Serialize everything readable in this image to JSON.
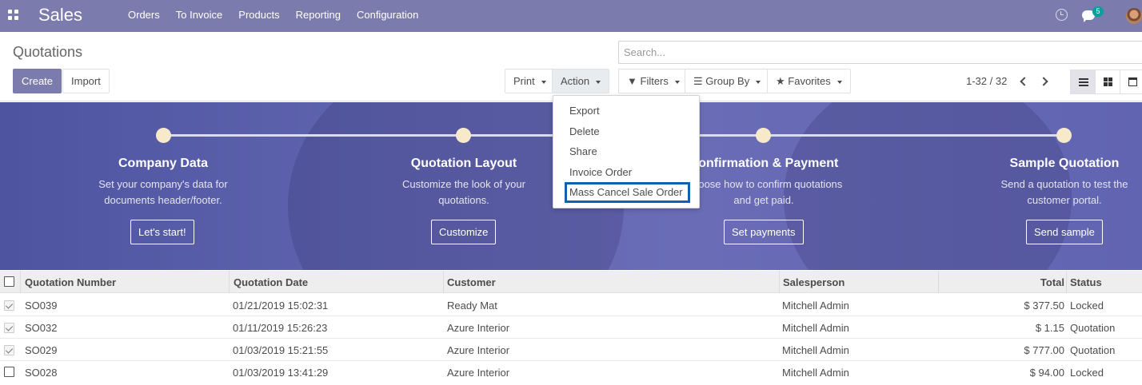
{
  "navbar": {
    "brand": "Sales",
    "menu": [
      "Orders",
      "To Invoice",
      "Products",
      "Reporting",
      "Configuration"
    ],
    "notification_count": "5"
  },
  "control_panel": {
    "title": "Quotations",
    "create_label": "Create",
    "import_label": "Import",
    "print_label": "Print",
    "action_label": "Action",
    "filters_label": "Filters",
    "group_by_label": "Group By",
    "favorites_label": "Favorites",
    "search_placeholder": "Search...",
    "pager": "1-32 / 32"
  },
  "action_menu": {
    "items": [
      "Export",
      "Delete",
      "Share",
      "Invoice Order",
      "Mass Cancel Sale Order"
    ],
    "highlighted": "Mass Cancel Sale Order"
  },
  "onboarding": {
    "steps": [
      {
        "title": "Company Data",
        "desc1": "Set your company's data for",
        "desc2": "documents header/footer.",
        "button": "Let's start!"
      },
      {
        "title": "Quotation Layout",
        "desc1": "Customize the look of your",
        "desc2": "quotations.",
        "button": "Customize"
      },
      {
        "title": "Confirmation & Payment",
        "desc1": "Choose how to confirm quotations",
        "desc2": "and get paid.",
        "button": "Set payments"
      },
      {
        "title": "Sample Quotation",
        "desc1": "Send a quotation to test the",
        "desc2": "customer portal.",
        "button": "Send sample"
      }
    ]
  },
  "table": {
    "columns": [
      "Quotation Number",
      "Quotation Date",
      "Customer",
      "Salesperson",
      "Total",
      "Status"
    ],
    "rows": [
      {
        "number": "SO039",
        "date": "01/21/2019 15:02:31",
        "customer": "Ready Mat",
        "salesperson": "Mitchell Admin",
        "total": "$ 377.50",
        "status": "Locked",
        "checked": true
      },
      {
        "number": "SO032",
        "date": "01/11/2019 15:26:23",
        "customer": "Azure Interior",
        "salesperson": "Mitchell Admin",
        "total": "$ 1.15",
        "status": "Quotation",
        "checked": true
      },
      {
        "number": "SO029",
        "date": "01/03/2019 15:21:55",
        "customer": "Azure Interior",
        "salesperson": "Mitchell Admin",
        "total": "$ 777.00",
        "status": "Quotation",
        "checked": true
      },
      {
        "number": "SO028",
        "date": "01/03/2019 13:41:29",
        "customer": "Azure Interior",
        "salesperson": "Mitchell Admin",
        "total": "$ 94.00",
        "status": "Locked",
        "checked": false
      }
    ]
  },
  "colors": {
    "brand": "#7c7bad",
    "highlight_border": "#1061b1",
    "badge": "#00a09d"
  }
}
